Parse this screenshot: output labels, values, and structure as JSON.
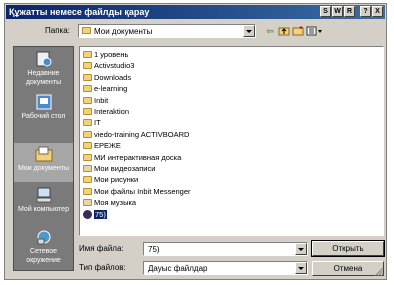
{
  "window": {
    "title": "Құжатты немесе файлды қарау"
  },
  "title_buttons": [
    "S",
    "W",
    "R",
    "?",
    "X"
  ],
  "folder_row": {
    "label": "Папка:",
    "value": "Мои документы"
  },
  "toolbar_icons": [
    "back-arrow-icon",
    "up-folder-icon",
    "new-folder-icon",
    "view-menu-icon"
  ],
  "places": [
    {
      "label": "Недавние документы",
      "icon": "recent-icon"
    },
    {
      "label": "Рабочий стол",
      "icon": "desktop-icon"
    },
    {
      "label": "Мои документы",
      "icon": "documents-icon"
    },
    {
      "label": "Мой компьютер",
      "icon": "computer-icon"
    },
    {
      "label": "Сетевое окружение",
      "icon": "network-icon"
    }
  ],
  "files": [
    {
      "name": "1 уровень",
      "type": "folder"
    },
    {
      "name": "Activstudio3",
      "type": "folder"
    },
    {
      "name": "Downloads",
      "type": "folder"
    },
    {
      "name": "e-learning",
      "type": "folder"
    },
    {
      "name": "Inbit",
      "type": "folder"
    },
    {
      "name": "Interaktion",
      "type": "folder"
    },
    {
      "name": "IT",
      "type": "folder"
    },
    {
      "name": "viedo-training ACTIVBOARD",
      "type": "folder"
    },
    {
      "name": "ЕРЕЖЕ",
      "type": "folder"
    },
    {
      "name": "МИ интерактивная доска",
      "type": "folder"
    },
    {
      "name": "Мои видеозаписи",
      "type": "special"
    },
    {
      "name": "Мои рисунки",
      "type": "folder"
    },
    {
      "name": "Мои файлы Inbit Messenger",
      "type": "folder"
    },
    {
      "name": "Моя музыка",
      "type": "special"
    },
    {
      "name": "75)",
      "type": "media",
      "selected": true
    }
  ],
  "filename": {
    "label": "Имя файла:",
    "value": "75)"
  },
  "filetype": {
    "label": "Тип файлов:",
    "value": "Дауыс файлдар"
  },
  "buttons": {
    "open": "Открыть",
    "cancel": "Отмена"
  }
}
